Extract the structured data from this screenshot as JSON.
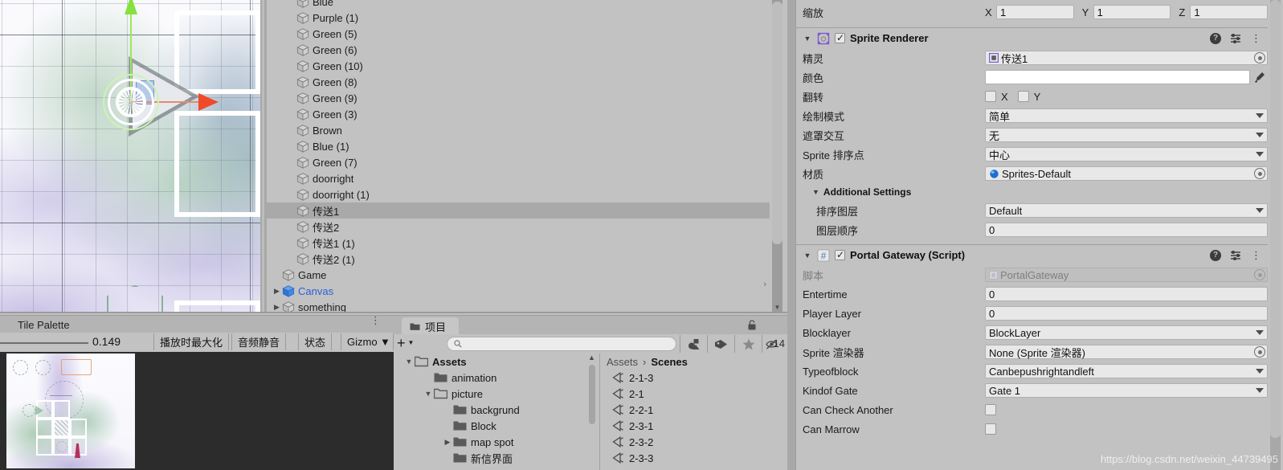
{
  "scene_view": {
    "name": "scene-view",
    "gizmo": "move-tool-gizmo",
    "axis_y_color": "#86e03e",
    "axis_x_color": "#f04a28"
  },
  "hierarchy": {
    "items": [
      {
        "label": "Blue",
        "indent": 1,
        "expandable": false,
        "selected": false,
        "blue": false
      },
      {
        "label": "Purple (1)",
        "indent": 1,
        "expandable": false,
        "selected": false,
        "blue": false
      },
      {
        "label": "Green (5)",
        "indent": 1,
        "expandable": false,
        "selected": false,
        "blue": false
      },
      {
        "label": "Green (6)",
        "indent": 1,
        "expandable": false,
        "selected": false,
        "blue": false
      },
      {
        "label": "Green (10)",
        "indent": 1,
        "expandable": false,
        "selected": false,
        "blue": false
      },
      {
        "label": "Green (8)",
        "indent": 1,
        "expandable": false,
        "selected": false,
        "blue": false
      },
      {
        "label": "Green (9)",
        "indent": 1,
        "expandable": false,
        "selected": false,
        "blue": false
      },
      {
        "label": "Green (3)",
        "indent": 1,
        "expandable": false,
        "selected": false,
        "blue": false
      },
      {
        "label": "Brown",
        "indent": 1,
        "expandable": false,
        "selected": false,
        "blue": false
      },
      {
        "label": "Blue (1)",
        "indent": 1,
        "expandable": false,
        "selected": false,
        "blue": false
      },
      {
        "label": "Green (7)",
        "indent": 1,
        "expandable": false,
        "selected": false,
        "blue": false
      },
      {
        "label": "doorright",
        "indent": 1,
        "expandable": false,
        "selected": false,
        "blue": false
      },
      {
        "label": "doorright (1)",
        "indent": 1,
        "expandable": false,
        "selected": false,
        "blue": false
      },
      {
        "label": "传送1",
        "indent": 1,
        "expandable": false,
        "selected": true,
        "blue": false
      },
      {
        "label": "传送2",
        "indent": 1,
        "expandable": false,
        "selected": false,
        "blue": false
      },
      {
        "label": "传送1 (1)",
        "indent": 1,
        "expandable": false,
        "selected": false,
        "blue": false
      },
      {
        "label": "传送2 (1)",
        "indent": 1,
        "expandable": false,
        "selected": false,
        "blue": false
      },
      {
        "label": "Game",
        "indent": 0,
        "expandable": false,
        "selected": false,
        "blue": false
      },
      {
        "label": "Canvas",
        "indent": 0,
        "expandable": true,
        "selected": false,
        "blue": true
      },
      {
        "label": "something",
        "indent": 0,
        "expandable": true,
        "selected": false,
        "blue": false
      }
    ]
  },
  "inspector": {
    "transform_scale": {
      "label": "缩放",
      "axes": [
        {
          "axis": "X",
          "value": "1"
        },
        {
          "axis": "Y",
          "value": "1"
        },
        {
          "axis": "Z",
          "value": "1"
        }
      ]
    },
    "sprite_renderer": {
      "title": "Sprite Renderer",
      "enabled": true,
      "rows": [
        {
          "label": "精灵",
          "type": "object",
          "value": "传送1",
          "kind": "sprite"
        },
        {
          "label": "颜色",
          "type": "color",
          "value": "#ffffff"
        },
        {
          "label": "翻转",
          "type": "flip",
          "x_label": "X",
          "y_label": "Y"
        },
        {
          "label": "绘制模式",
          "type": "dropdown",
          "value": "简单"
        },
        {
          "label": "遮罩交互",
          "type": "dropdown",
          "value": "无"
        },
        {
          "label": "Sprite 排序点",
          "type": "dropdown",
          "value": "中心"
        },
        {
          "label": "材质",
          "type": "object",
          "value": "Sprites-Default",
          "kind": "material"
        }
      ],
      "additional_settings": {
        "label": "Additional Settings",
        "rows": [
          {
            "label": "排序图层",
            "type": "dropdown",
            "value": "Default"
          },
          {
            "label": "图层顺序",
            "type": "text",
            "value": "0"
          }
        ]
      }
    },
    "portal_gateway": {
      "title": "Portal Gateway (Script)",
      "enabled": true,
      "rows": [
        {
          "label": "脚本",
          "type": "object-dim",
          "value": "PortalGateway"
        },
        {
          "label": "Entertime",
          "type": "text",
          "value": "0"
        },
        {
          "label": "Player Layer",
          "type": "text",
          "value": "0"
        },
        {
          "label": "Blocklayer",
          "type": "dropdown",
          "value": "BlockLayer"
        },
        {
          "label": "Sprite 渲染器",
          "type": "object",
          "value": "None (Sprite 渲染器)"
        },
        {
          "label": "Typeofblock",
          "type": "dropdown",
          "value": "Canbepushrightandleft"
        },
        {
          "label": "Kindof Gate",
          "type": "dropdown",
          "value": "Gate 1"
        },
        {
          "label": "Can Check Another",
          "type": "checkbox",
          "value": false
        },
        {
          "label": "Can Marrow",
          "type": "checkbox",
          "value": false
        }
      ]
    },
    "watermark": "https://blog.csdn.net/weixin_44739495"
  },
  "tile_palette": {
    "tab_title": "Tile Palette",
    "zoom_value": "0.149",
    "buttons": [
      {
        "label": "播放时最大化"
      },
      {
        "label": "音频静音"
      },
      {
        "label": "状态"
      },
      {
        "label": "Gizmos"
      }
    ]
  },
  "project": {
    "tab_title": "项目",
    "search_placeholder": "",
    "hidden_count": "14",
    "tree": [
      {
        "label": "Assets",
        "indent": 0,
        "expandable": true,
        "expanded": true,
        "bold": true,
        "open_folder": true
      },
      {
        "label": "animation",
        "indent": 1,
        "expandable": false,
        "expanded": false,
        "bold": false,
        "open_folder": false
      },
      {
        "label": "picture",
        "indent": 1,
        "expandable": true,
        "expanded": true,
        "bold": false,
        "open_folder": true
      },
      {
        "label": "backgrund",
        "indent": 2,
        "expandable": false,
        "expanded": false,
        "bold": false,
        "open_folder": false
      },
      {
        "label": "Block",
        "indent": 2,
        "expandable": false,
        "expanded": false,
        "bold": false,
        "open_folder": false
      },
      {
        "label": "map spot",
        "indent": 2,
        "expandable": true,
        "expanded": false,
        "bold": false,
        "open_folder": false
      },
      {
        "label": "新信界面",
        "indent": 2,
        "expandable": false,
        "expanded": false,
        "bold": false,
        "open_folder": false
      }
    ],
    "breadcrumb": {
      "root": "Assets",
      "separator": "›",
      "current": "Scenes"
    },
    "files": [
      {
        "name": "2-1-3"
      },
      {
        "name": "2-1"
      },
      {
        "name": "2-2-1"
      },
      {
        "name": "2-3-1"
      },
      {
        "name": "2-3-2"
      },
      {
        "name": "2-3-3"
      }
    ]
  }
}
